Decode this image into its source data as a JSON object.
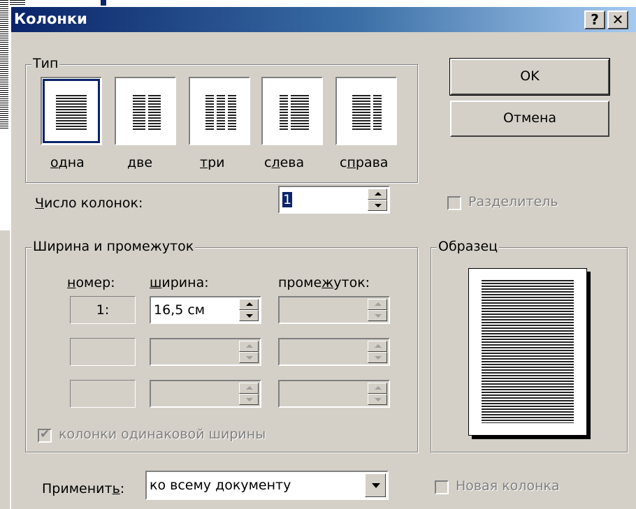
{
  "dialog": {
    "title": "Колонки",
    "help_glyph": "?",
    "close_glyph": "✕"
  },
  "type_group": {
    "label": "Тип",
    "options": [
      {
        "label": "одна",
        "mnemonic": "о",
        "rest": "дна"
      },
      {
        "label": "две",
        "mnemonic": "д",
        "rest": "ве"
      },
      {
        "label": "три",
        "mnemonic": "т",
        "rest": "ри"
      },
      {
        "label": "слева",
        "pre": "с",
        "mnemonic": "л",
        "rest": "ева"
      },
      {
        "label": "справа",
        "pre": "с",
        "mnemonic": "п",
        "rest": "рава"
      }
    ],
    "selected": "одна"
  },
  "buttons": {
    "ok": "OK",
    "cancel": "Отмена"
  },
  "num_columns": {
    "label_mnemonic": "Ч",
    "label_rest": "исло колонок:",
    "value": "1"
  },
  "separator": {
    "label": "Разделитель",
    "checked": false,
    "disabled": true
  },
  "width_spacing": {
    "label": "Ширина и промежуток",
    "col_number_header_mnemonic": "н",
    "col_number_header_rest": "омер:",
    "col_width_header_mnemonic": "ш",
    "col_width_header_rest": "ирина:",
    "col_spacing_header_pre": "проме",
    "col_spacing_header_mnemonic": "ж",
    "col_spacing_header_rest": "уток:",
    "rows": [
      {
        "number": "1:",
        "width": "16,5 см",
        "spacing": ""
      },
      {
        "number": "",
        "width": "",
        "spacing": ""
      },
      {
        "number": "",
        "width": "",
        "spacing": ""
      }
    ]
  },
  "equal_width": {
    "label": "колонки одинаковой ширины",
    "checked": true,
    "disabled": true
  },
  "preview": {
    "label": "Образец"
  },
  "apply": {
    "label_pre": "Применит",
    "label_mnemonic": "ь",
    "label_post": ":",
    "value": "ко всему документу"
  },
  "new_column": {
    "label": "Новая колонка",
    "checked": false,
    "disabled": true
  },
  "colors": {
    "titlebar_start": "#0a246a",
    "titlebar_end": "#a6caf0",
    "face": "#d4d0c8"
  }
}
